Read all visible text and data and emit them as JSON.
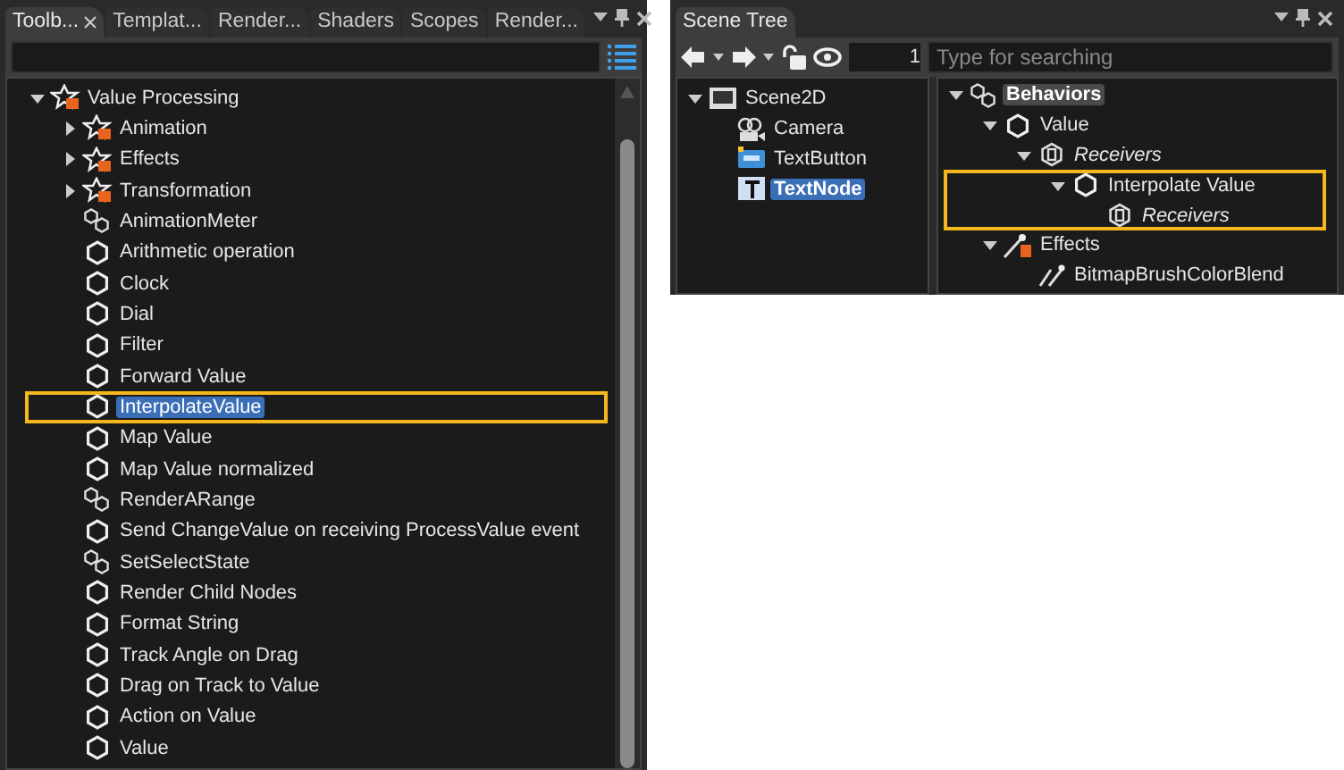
{
  "toolbox": {
    "tabs": [
      {
        "label": "Toolb...",
        "selected": true,
        "closable": true
      },
      {
        "label": "Templat...",
        "selected": false,
        "closable": false
      },
      {
        "label": "Render...",
        "selected": false,
        "closable": false
      },
      {
        "label": "Shaders",
        "selected": false,
        "closable": false
      },
      {
        "label": "Scopes",
        "selected": false,
        "closable": false
      },
      {
        "label": "Render...",
        "selected": false,
        "closable": false
      }
    ],
    "tree": [
      {
        "label": "Value Processing",
        "kind": "folder",
        "expanded": true,
        "selected": false,
        "annotated": false,
        "children": [
          {
            "label": "Animation",
            "kind": "folder",
            "expanded": false,
            "selected": false,
            "annotated": false
          },
          {
            "label": "Effects",
            "kind": "folder",
            "expanded": false,
            "selected": false,
            "annotated": false
          },
          {
            "label": "Transformation",
            "kind": "folder",
            "expanded": false,
            "selected": false,
            "annotated": false
          },
          {
            "label": "AnimationMeter",
            "kind": "group",
            "selected": false,
            "annotated": false
          },
          {
            "label": "Arithmetic operation",
            "kind": "behavior",
            "selected": false,
            "annotated": false
          },
          {
            "label": "Clock",
            "kind": "behavior",
            "selected": false,
            "annotated": false
          },
          {
            "label": "Dial",
            "kind": "behavior",
            "selected": false,
            "annotated": false
          },
          {
            "label": "Filter",
            "kind": "behavior",
            "selected": false,
            "annotated": false
          },
          {
            "label": "Forward Value",
            "kind": "behavior",
            "selected": false,
            "annotated": false
          },
          {
            "label": "InterpolateValue",
            "kind": "behavior",
            "selected": true,
            "annotated": true
          },
          {
            "label": "Map Value",
            "kind": "behavior",
            "selected": false,
            "annotated": false
          },
          {
            "label": "Map Value normalized",
            "kind": "behavior",
            "selected": false,
            "annotated": false
          },
          {
            "label": "RenderARange",
            "kind": "group",
            "selected": false,
            "annotated": false
          },
          {
            "label": "Send ChangeValue on receiving ProcessValue event",
            "kind": "behavior",
            "selected": false,
            "annotated": false
          },
          {
            "label": "SetSelectState",
            "kind": "group",
            "selected": false,
            "annotated": false
          },
          {
            "label": "Render Child Nodes",
            "kind": "behavior",
            "selected": false,
            "annotated": false
          },
          {
            "label": "Format String",
            "kind": "behavior",
            "selected": false,
            "annotated": false
          },
          {
            "label": "Track Angle on Drag",
            "kind": "behavior",
            "selected": false,
            "annotated": false
          },
          {
            "label": "Drag on Track to Value",
            "kind": "behavior",
            "selected": false,
            "annotated": false
          },
          {
            "label": "Action on Value",
            "kind": "behavior",
            "selected": false,
            "annotated": false
          },
          {
            "label": "Value",
            "kind": "behavior",
            "selected": false,
            "annotated": false
          }
        ]
      }
    ]
  },
  "scene_tree": {
    "tabs": [
      {
        "label": "Scene Tree",
        "selected": true,
        "closable": false
      }
    ],
    "number_field": {
      "value": "1"
    },
    "search": {
      "placeholder": "Type for searching"
    },
    "nodes": [
      {
        "label": "Scene2D",
        "kind": "scene",
        "expanded": true,
        "selected": false,
        "annotated": false,
        "children": [
          {
            "label": "Camera",
            "kind": "camera",
            "selected": false,
            "annotated": false
          },
          {
            "label": "TextButton",
            "kind": "textbutton",
            "selected": false,
            "annotated": false
          },
          {
            "label": "TextNode",
            "kind": "textnode",
            "selected": true,
            "annotated": false
          }
        ]
      }
    ],
    "behaviors": [
      {
        "label": "Behaviors",
        "kind": "group",
        "expanded": true,
        "selected": true,
        "annotated": false,
        "children": [
          {
            "label": "Value",
            "kind": "behavior",
            "expanded": true,
            "selected": false,
            "annotated": false,
            "children": [
              {
                "label": "Receivers",
                "kind": "property",
                "expanded": true,
                "selected": false,
                "annotated": false,
                "children": [
                  {
                    "label": "Interpolate Value",
                    "kind": "behavior",
                    "expanded": true,
                    "selected": false,
                    "annotated": true,
                    "children": [
                      {
                        "label": "Receivers",
                        "kind": "property",
                        "selected": false,
                        "annotated": false
                      }
                    ]
                  }
                ]
              }
            ]
          },
          {
            "label": "Effects",
            "kind": "effects",
            "expanded": true,
            "selected": false,
            "annotated": false,
            "children": [
              {
                "label": "BitmapBrushColorBlend",
                "kind": "brush",
                "selected": false,
                "annotated": false
              }
            ]
          }
        ]
      }
    ]
  }
}
